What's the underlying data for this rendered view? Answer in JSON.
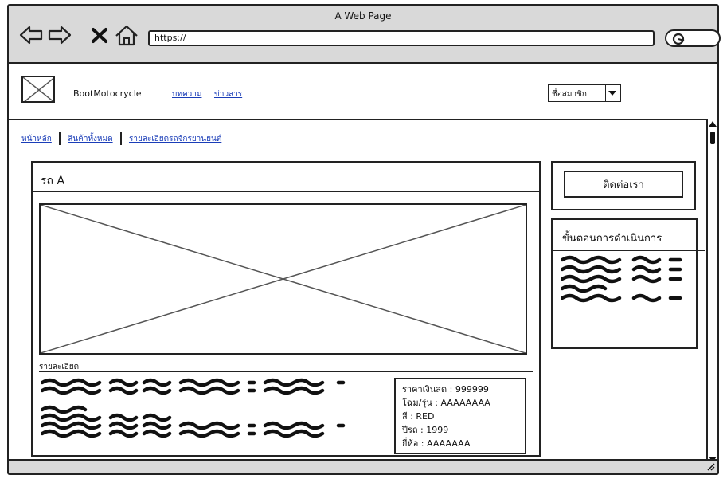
{
  "window": {
    "title": "A Web Page"
  },
  "browser": {
    "url": "https://",
    "icons": [
      "back-icon",
      "forward-icon",
      "close-icon",
      "home-icon",
      "search-icon"
    ]
  },
  "header": {
    "brand": "BootMotocrycle",
    "nav": [
      "บทความ",
      "ข่าวสาร"
    ],
    "user_select": "ชื่อสมาชิก"
  },
  "breadcrumb": [
    "หน้าหลัก",
    "สินค้าทั้งหมด",
    "รายละเอียดรถจักรยานยนต์"
  ],
  "product": {
    "title": "รถ A",
    "detail_label": "รายละเอียด",
    "specs": [
      "ราคาเงินสด : 999999",
      "โฉม/รุ่น : AAAAAAAA",
      "สี : RED",
      "ปีรถ : 1999",
      "ยี่ห้อ : AAAAAAA"
    ]
  },
  "sidebar": {
    "contact_label": "ติดต่อเรา",
    "steps_title": "ขั้นตอนการดำเนินการ"
  }
}
